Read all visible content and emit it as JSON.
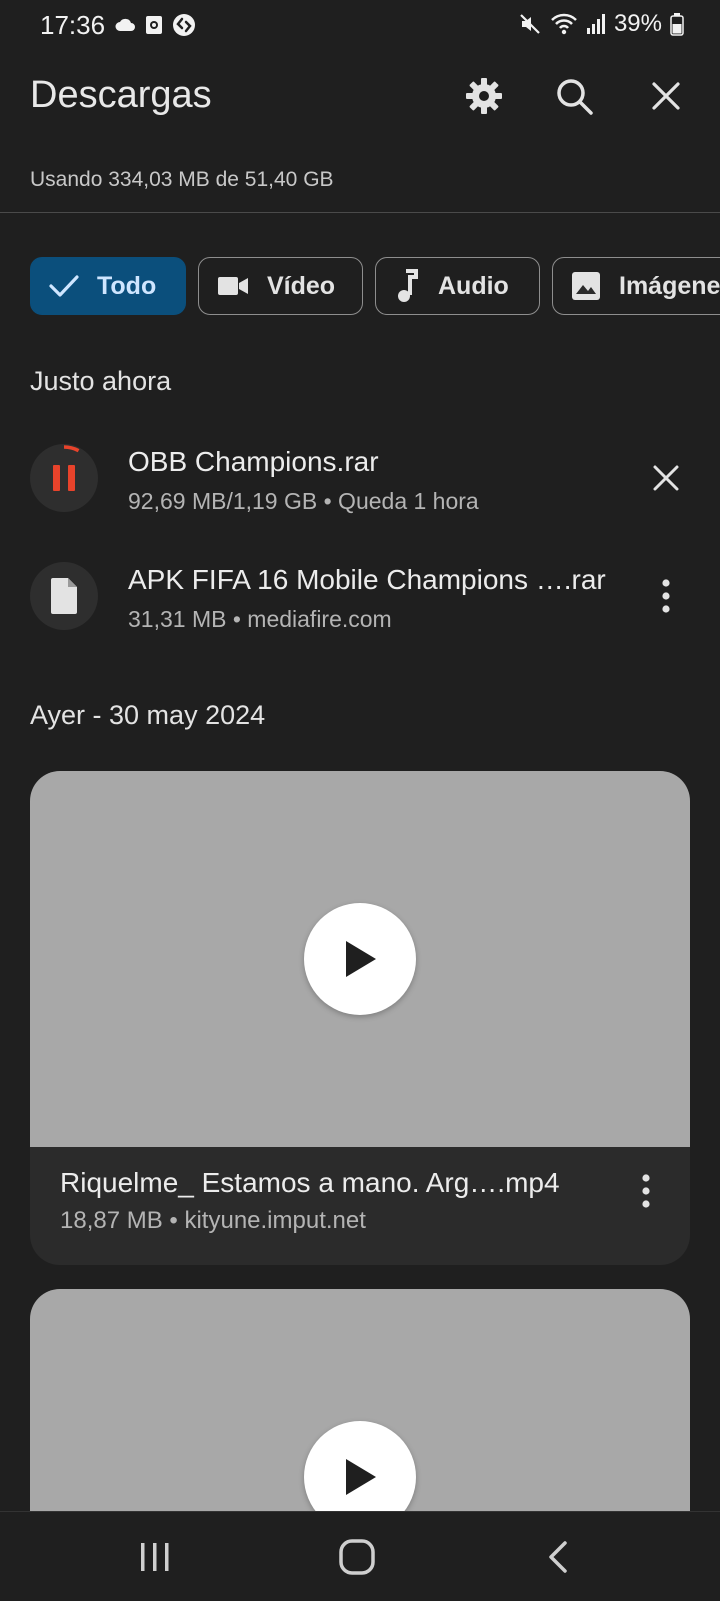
{
  "status_bar": {
    "time": "17:36",
    "battery": "39%",
    "left_icons": [
      "cloud-icon",
      "screen-record-icon",
      "shazam-icon"
    ],
    "right_icons": [
      "mute-icon",
      "wifi-icon",
      "signal-icon",
      "battery-icon"
    ]
  },
  "header": {
    "title": "Descargas",
    "icons": [
      "gear-icon",
      "search-icon",
      "close-icon"
    ]
  },
  "storage": {
    "text": "Usando 334,03 MB de 51,40 GB"
  },
  "filters": [
    {
      "label": "Todo",
      "icon": "check-icon",
      "selected": true
    },
    {
      "label": "Vídeo",
      "icon": "video-camera-icon",
      "selected": false
    },
    {
      "label": "Audio",
      "icon": "music-note-icon",
      "selected": false
    },
    {
      "label": "Imágene",
      "icon": "image-icon",
      "selected": false
    }
  ],
  "sections": {
    "recent": {
      "title": "Justo ahora",
      "items": [
        {
          "name": "OBB Champions.rar",
          "meta": "92,69 MB/1,19 GB • Queda 1 hora",
          "icon": "pause-icon",
          "action": "close-icon",
          "progress": 0.078
        },
        {
          "name": "APK FIFA 16 Mobile Champions ….rar",
          "meta": "31,31 MB • mediafire.com",
          "icon": "file-icon",
          "action": "more-vert-icon"
        }
      ]
    },
    "yesterday": {
      "title": "Ayer - 30 may 2024",
      "items": [
        {
          "name": "Riquelme_ Estamos a mano. Arg….mp4",
          "meta": "18,87 MB • kityune.imput.net",
          "icon": "play-icon"
        }
      ]
    }
  },
  "colors": {
    "background": "#1f1f1f",
    "accent_chip": "#0b4f7c",
    "progress": "#e8432b",
    "thumbnail": "#a8a8a8"
  },
  "nav_bar": {
    "icons": [
      "recent-apps-icon",
      "home-icon",
      "back-icon"
    ]
  }
}
